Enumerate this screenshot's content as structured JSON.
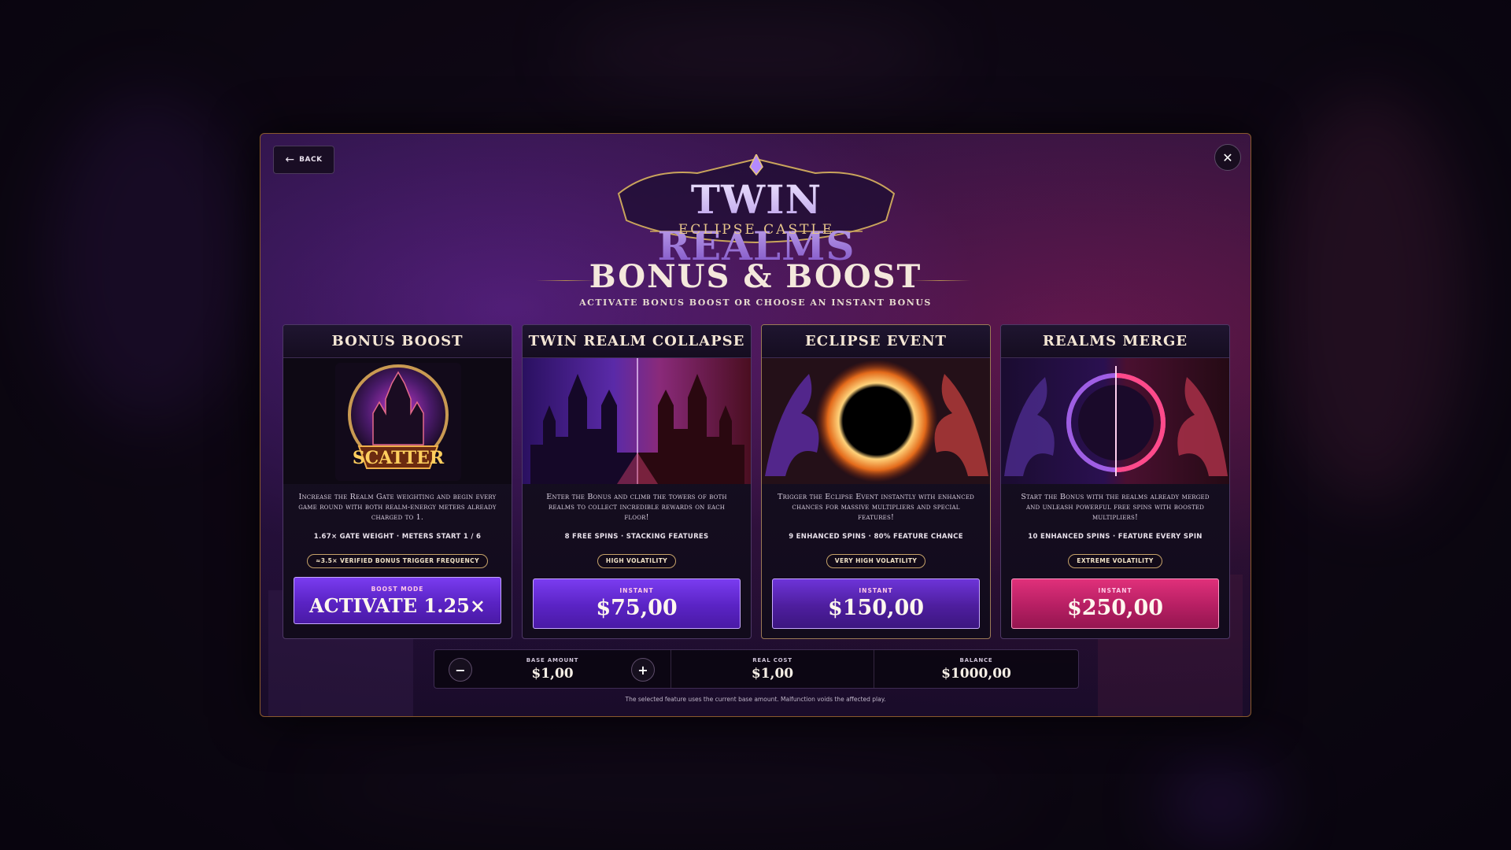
{
  "header": {
    "back_label": "BACK",
    "close_label": "✕"
  },
  "logo": {
    "title": "TWIN REALMS",
    "subtitle": "ECLIPSE CASTLE"
  },
  "heading": {
    "title": "BONUS & BOOST",
    "subtitle": "ACTIVATE BONUS BOOST OR CHOOSE AN INSTANT BONUS"
  },
  "cards": [
    {
      "title": "BONUS BOOST",
      "art_text": "SCATTER",
      "description": "Increase the Realm Gate weighting and begin every game round with both realm-energy meters already charged to 1.",
      "stats": "1.67× GATE WEIGHT · METERS START 1 / 6",
      "badge": "≈3.5× VERIFIED BONUS TRIGGER FREQUENCY",
      "button_small": "BOOST MODE",
      "button_big": "ACTIVATE 1.25×"
    },
    {
      "title": "TWIN REALM COLLAPSE",
      "description": "Enter the Bonus and climb the towers of both realms to collect incredible rewards on each floor!",
      "stats": "8 FREE SPINS · STACKING FEATURES",
      "badge": "HIGH VOLATILITY",
      "button_small": "INSTANT",
      "button_big": "$75,00"
    },
    {
      "title": "ECLIPSE EVENT",
      "description": "Trigger the Eclipse Event instantly with enhanced chances for massive multipliers and special features!",
      "stats": "9 ENHANCED SPINS · 80% FEATURE CHANCE",
      "badge": "VERY HIGH VOLATILITY",
      "button_small": "INSTANT",
      "button_big": "$150,00"
    },
    {
      "title": "REALMS MERGE",
      "description": "Start the Bonus with the realms already merged and unleash powerful free spins with boosted multipliers!",
      "stats": "10 ENHANCED SPINS · FEATURE EVERY SPIN",
      "badge": "EXTREME VOLATILITY",
      "button_small": "INSTANT",
      "button_big": "$250,00"
    }
  ],
  "amounts": {
    "base_label": "BASE AMOUNT",
    "base_value": "$1,00",
    "minus": "−",
    "plus": "+",
    "cost_label": "REAL COST",
    "cost_value": "$1,00",
    "balance_label": "BALANCE",
    "balance_value": "$1000,00"
  },
  "footnote": "The selected feature uses the current base amount. Malfunction voids the affected play.",
  "colors": {
    "accent_purple": "#6a2fe0",
    "accent_pink": "#c8246c",
    "gold": "#c5a26a"
  }
}
